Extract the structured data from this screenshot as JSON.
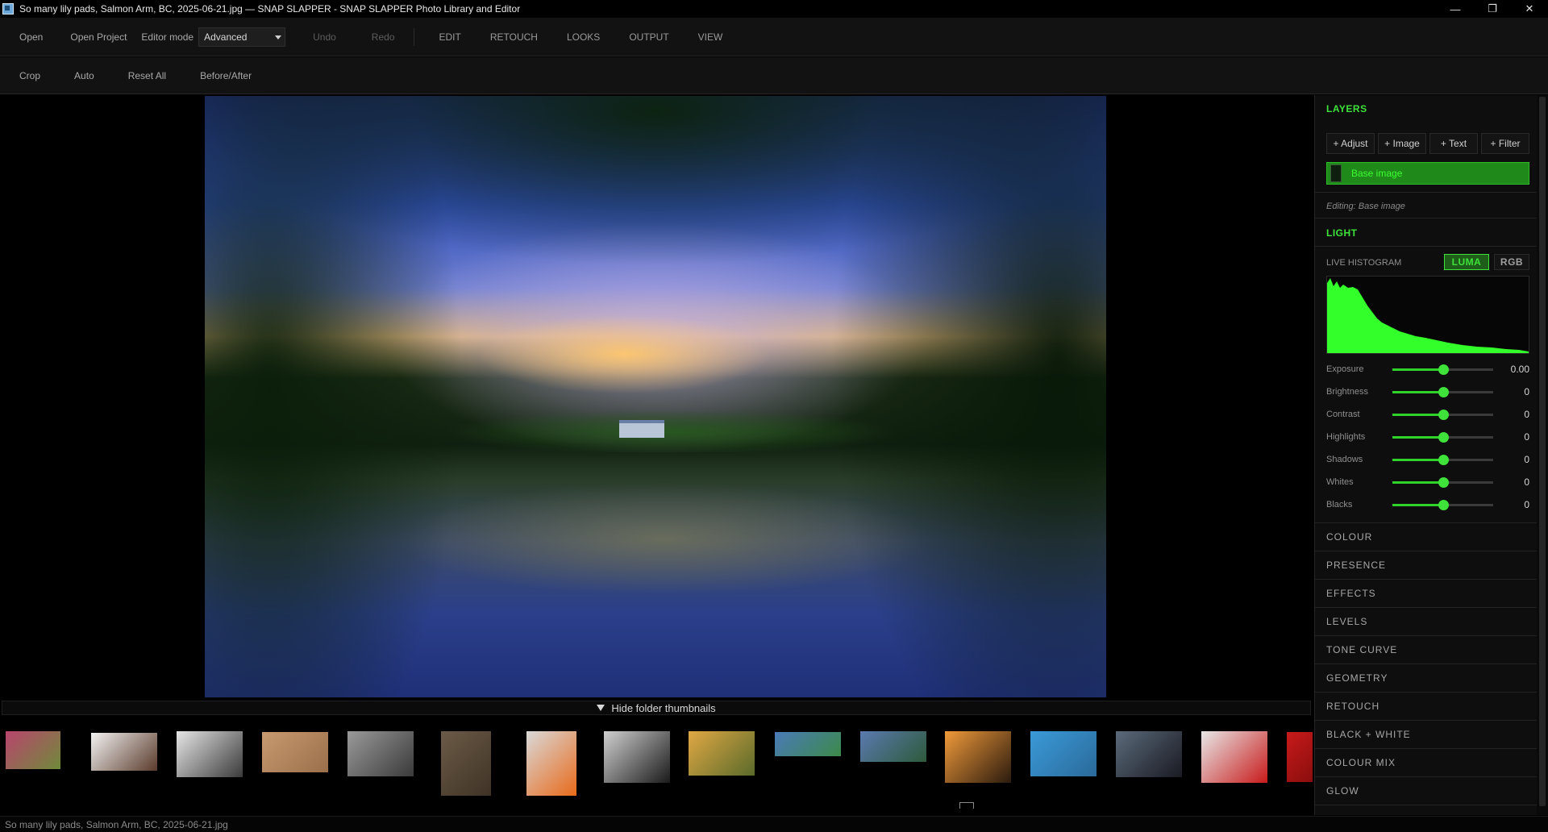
{
  "window": {
    "title": "So many lily pads, Salmon Arm, BC, 2025-06-21.jpg — SNAP SLAPPER - SNAP SLAPPER Photo Library and Editor",
    "minimize_glyph": "—",
    "maximize_glyph": "❐",
    "close_glyph": "✕"
  },
  "menubar": {
    "open": "Open",
    "open_project": "Open Project",
    "editor_mode_label": "Editor mode",
    "editor_mode_value": "Advanced",
    "undo": "Undo",
    "redo": "Redo",
    "nav": [
      "EDIT",
      "RETOUCH",
      "LOOKS",
      "OUTPUT",
      "VIEW"
    ]
  },
  "toolbar": {
    "items": [
      "Crop",
      "Auto",
      "Reset All",
      "Before/After"
    ]
  },
  "thumbs_header": "Hide folder thumbnails",
  "thumbnails": [
    {
      "colors": [
        "#b9456e",
        "#6f8a3a"
      ]
    },
    {
      "colors": [
        "#f2f2f2",
        "#5a3a2a"
      ]
    },
    {
      "colors": [
        "#e6e6e6",
        "#3a3a3a"
      ]
    },
    {
      "colors": [
        "#c89a70",
        "#9a6f4a"
      ]
    },
    {
      "colors": [
        "#9a9a9a",
        "#3a3a3a"
      ]
    },
    {
      "colors": [
        "#6b5a46",
        "#3f3326"
      ]
    },
    {
      "colors": [
        "#d9d9d9",
        "#e86a1a"
      ]
    },
    {
      "colors": [
        "#d0d0d0",
        "#1a1a1a"
      ]
    },
    {
      "colors": [
        "#e0a844",
        "#5a6a2a"
      ]
    },
    {
      "colors": [
        "#4a7ab8",
        "#3c8a4a"
      ]
    },
    {
      "colors": [
        "#5a7ab0",
        "#2e5a3a"
      ]
    },
    {
      "colors": [
        "#f09a3a",
        "#2a1a0e"
      ]
    },
    {
      "colors": [
        "#3a9ad8",
        "#2a6a9a"
      ]
    },
    {
      "colors": [
        "#5a6a7a",
        "#1a1a22"
      ]
    },
    {
      "colors": [
        "#e8e8e8",
        "#c81a1a"
      ]
    },
    {
      "colors": [
        "#c81a1a",
        "#8a0e0e"
      ]
    }
  ],
  "status": "So many lily pads, Salmon Arm, BC, 2025-06-21.jpg",
  "panel": {
    "layers_title": "LAYERS",
    "layer_buttons": [
      "+ Adjust",
      "+ Image",
      "+ Text",
      "+ Filter"
    ],
    "base_layer": "Base image",
    "editing": "Editing: Base image",
    "light_title": "LIGHT",
    "histogram_label": "LIVE HISTOGRAM",
    "hist_modes": {
      "luma": "LUMA",
      "rgb": "RGB"
    },
    "histogram_color": "#33ff2a",
    "sliders": [
      {
        "label": "Exposure",
        "value": "0.00",
        "position": 0.5
      },
      {
        "label": "Brightness",
        "value": "0",
        "position": 0.5
      },
      {
        "label": "Contrast",
        "value": "0",
        "position": 0.5
      },
      {
        "label": "Highlights",
        "value": "0",
        "position": 0.5
      },
      {
        "label": "Shadows",
        "value": "0",
        "position": 0.5
      },
      {
        "label": "Whites",
        "value": "0",
        "position": 0.5
      },
      {
        "label": "Blacks",
        "value": "0",
        "position": 0.5
      }
    ],
    "categories": [
      "COLOUR",
      "PRESENCE",
      "EFFECTS",
      "LEVELS",
      "TONE CURVE",
      "GEOMETRY",
      "RETOUCH",
      "BLACK + WHITE",
      "COLOUR MIX",
      "GLOW"
    ]
  },
  "accent_color": "#3ee23a"
}
